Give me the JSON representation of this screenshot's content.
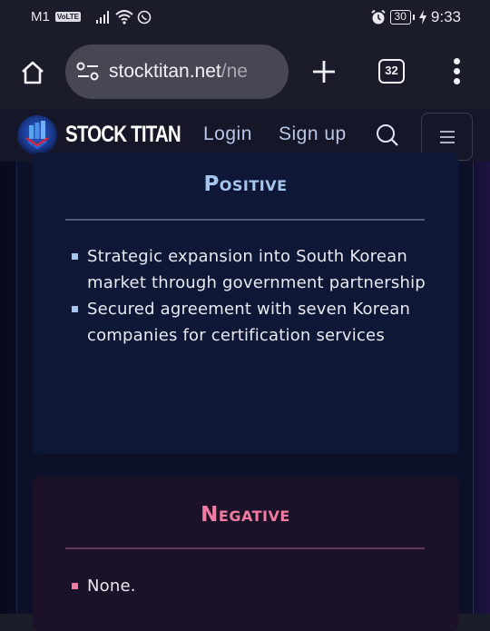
{
  "status_bar": {
    "carrier": "M1",
    "volte_badge": "VoLTE",
    "battery_level": "30",
    "time": "9:33",
    "icons": [
      "signal-icon",
      "wifi-icon",
      "whatsapp-icon",
      "alarm-icon",
      "battery-icon",
      "charging-icon"
    ]
  },
  "browser": {
    "url_domain": "stocktitan.net",
    "url_path": "/ne",
    "tab_count": "32",
    "icons": [
      "home-icon",
      "site-settings-icon",
      "new-tab-icon",
      "tabs-icon",
      "more-menu-icon"
    ]
  },
  "site_nav": {
    "brand": "STOCK TITAN",
    "login": "Login",
    "signup": "Sign up",
    "icons": [
      "logo-icon",
      "search-icon",
      "hamburger-menu-icon"
    ]
  },
  "positive": {
    "title": "Positive",
    "accent": "#a5c6ef",
    "items": [
      "Strategic expansion into South Korean market through government partnership",
      "Secured agreement with seven Korean companies for certification services"
    ]
  },
  "negative": {
    "title": "Negative",
    "accent": "#f17ca0",
    "items": [
      "None."
    ]
  }
}
